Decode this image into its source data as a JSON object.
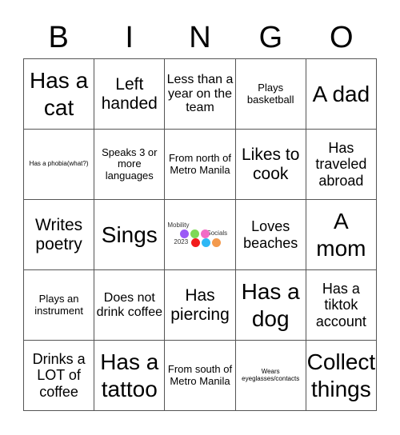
{
  "header": [
    "B",
    "I",
    "N",
    "G",
    "O"
  ],
  "cells": [
    {
      "text": "Has a cat",
      "size": "xxl"
    },
    {
      "text": "Left handed",
      "size": "xl"
    },
    {
      "text": "Less than a year on the team",
      "size": "md"
    },
    {
      "text": "Plays basketball",
      "size": "sm"
    },
    {
      "text": "A dad",
      "size": "xxl"
    },
    {
      "text": "Has a phobia(what?)",
      "size": "xs"
    },
    {
      "text": "Speaks 3 or more languages",
      "size": "sm"
    },
    {
      "text": "From north of Metro Manila",
      "size": "sm"
    },
    {
      "text": "Likes to cook",
      "size": "xl"
    },
    {
      "text": "Has traveled abroad",
      "size": "lg"
    },
    {
      "text": "Writes poetry",
      "size": "xl"
    },
    {
      "text": "Sings",
      "size": "xxl"
    },
    {
      "free": true,
      "title": "Mobility",
      "subtitle": "Socials",
      "year": "2023",
      "dots": [
        "#9b59f6",
        "#7ed957",
        "#f26bc5",
        "#f21c1c",
        "#2eb8f5",
        "#f39a4e"
      ]
    },
    {
      "text": "Loves beaches",
      "size": "lg"
    },
    {
      "text": "A mom",
      "size": "xxl"
    },
    {
      "text": "Plays an instrument",
      "size": "sm"
    },
    {
      "text": "Does not drink coffee",
      "size": "md"
    },
    {
      "text": "Has piercing",
      "size": "xl"
    },
    {
      "text": "Has a dog",
      "size": "xxl"
    },
    {
      "text": "Has a tiktok account",
      "size": "lg"
    },
    {
      "text": "Drinks a LOT of coffee",
      "size": "lg"
    },
    {
      "text": "Has a tattoo",
      "size": "xxl"
    },
    {
      "text": "From south of Metro Manila",
      "size": "sm"
    },
    {
      "text": "Wears eyeglasses/contacts",
      "size": "xs"
    },
    {
      "text": "Collect things",
      "size": "xxl"
    }
  ]
}
